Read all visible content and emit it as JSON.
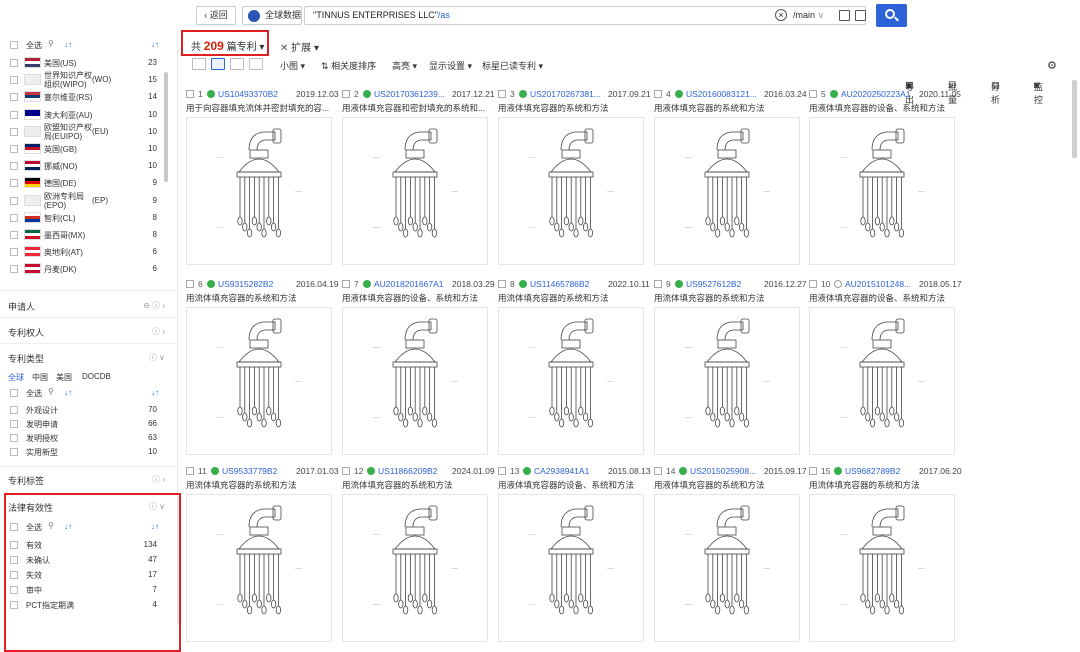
{
  "topbar": {
    "back_label": "返回",
    "scope_label": "全球数据",
    "query_main": "\"TINNUS ENTERPRISES LLC\"",
    "query_suffix": "/as",
    "field_select": "/main",
    "clear_icon": "close-circle-icon",
    "search_icon": "search-icon",
    "accent": "#2d62d8"
  },
  "sidebar": {
    "select_all": "全选",
    "countries": [
      {
        "label": "美国(US)",
        "count": "23",
        "flag": [
          "#b22234",
          "#fff",
          "#3c3b6e"
        ]
      },
      {
        "label": "世界知识产权组织(WIPO)",
        "label_short": "世界知识产权组织(WIPO)",
        "code": "(WO)",
        "count": "15",
        "flag": [
          "#eee",
          "#eee",
          "#eee"
        ]
      },
      {
        "label": "塞尔维亚(RS)",
        "count": "14",
        "flag": [
          "#c6363c",
          "#0c4076",
          "#fff"
        ]
      },
      {
        "label": "澳大利亚(AU)",
        "count": "10",
        "flag": [
          "#00008b",
          "#00008b",
          "#fff"
        ]
      },
      {
        "label": "欧盟知识产权局(EUIPO)",
        "code": "(EU)",
        "count": "10",
        "flag": [
          "#eee",
          "#eee",
          "#eee"
        ]
      },
      {
        "label": "英国(GB)",
        "count": "10",
        "flag": [
          "#012169",
          "#c8102e",
          "#fff"
        ]
      },
      {
        "label": "挪威(NO)",
        "count": "10",
        "flag": [
          "#ba0c2f",
          "#fff",
          "#00205b"
        ]
      },
      {
        "label": "德国(DE)",
        "count": "9",
        "flag": [
          "#000",
          "#dd0000",
          "#ffce00"
        ]
      },
      {
        "label": "欧洲专利局(EPO)",
        "code": "(EP)",
        "count": "9",
        "flag": [
          "#eee",
          "#eee",
          "#eee"
        ]
      },
      {
        "label": "智利(CL)",
        "count": "8",
        "flag": [
          "#fff",
          "#d52b1e",
          "#0039a6"
        ]
      },
      {
        "label": "墨西哥(MX)",
        "count": "8",
        "flag": [
          "#006847",
          "#fff",
          "#ce1126"
        ]
      },
      {
        "label": "奥地利(AT)",
        "count": "6",
        "flag": [
          "#ed2939",
          "#fff",
          "#ed2939"
        ]
      },
      {
        "label": "丹麦(DK)",
        "count": "6",
        "flag": [
          "#c60c30",
          "#fff",
          "#c60c30"
        ]
      }
    ],
    "sections": {
      "applicant": "申请人",
      "patentee": "专利权人",
      "patent_type": "专利类型",
      "patent_tabs": [
        "全球",
        "中国",
        "美国",
        "DOCDB"
      ],
      "patent_types": [
        {
          "label": "外观设计",
          "count": "70"
        },
        {
          "label": "发明申请",
          "count": "66"
        },
        {
          "label": "发明授权",
          "count": "63"
        },
        {
          "label": "实用新型",
          "count": "10"
        }
      ],
      "patent_tags": "专利标签",
      "legal_status": "法律有效性",
      "legal": [
        {
          "label": "有效",
          "count": "134"
        },
        {
          "label": "未确认",
          "count": "47"
        },
        {
          "label": "失效",
          "count": "17"
        },
        {
          "label": "审中",
          "count": "7"
        },
        {
          "label": "PCT指定期满",
          "count": "4"
        }
      ]
    }
  },
  "header": {
    "count_prefix": "共",
    "count": "209",
    "count_suffix": "篇专利",
    "expand": "扩展",
    "view_size": "小图",
    "sort": "相关度排序",
    "highlight": "高亮",
    "display": "显示设置",
    "read": "标星已读专利",
    "export": "导出",
    "batch": "批量",
    "analyze": "分析",
    "monitor": "监控"
  },
  "cards": [
    {
      "num": "1",
      "pn": "US10493370B2",
      "date": "2019.12.03",
      "title": "用于向容器填充流体并密封填充的容...",
      "status": "green"
    },
    {
      "num": "2",
      "pn": "US20170361239...",
      "date": "2017.12.21",
      "title": "用液体填充容器和密封填充的系统和...",
      "status": "green"
    },
    {
      "num": "3",
      "pn": "US20170267381...",
      "date": "2017.09.21",
      "title": "用液体填充容器的系统和方法",
      "status": "green"
    },
    {
      "num": "4",
      "pn": "US20160083121...",
      "date": "2016.03.24",
      "title": "用液体填充容器的系统和方法",
      "status": "green"
    },
    {
      "num": "5",
      "pn": "AU2020250223A1",
      "date": "2020.11.05",
      "title": "用液体填充容器的设备、系统和方法",
      "status": "green"
    },
    {
      "num": "6",
      "pn": "US9315282B2",
      "date": "2016.04.19",
      "title": "用流体填充容器的系统和方法",
      "status": "green"
    },
    {
      "num": "7",
      "pn": "AU2018201667A1",
      "date": "2018.03.29",
      "title": "用液体填充容器的设备、系统和方法",
      "status": "green"
    },
    {
      "num": "8",
      "pn": "US11465786B2",
      "date": "2022.10.11",
      "title": "用流体填充容器的系统和方法",
      "status": "green"
    },
    {
      "num": "9",
      "pn": "US9527612B2",
      "date": "2016.12.27",
      "title": "用流体填充容器的系统和方法",
      "status": "green"
    },
    {
      "num": "10",
      "pn": "AU2015101248...",
      "date": "2018.05.17",
      "title": "用液体填充容器的设备、系统和方法",
      "status": "grey"
    },
    {
      "num": "11",
      "pn": "US9533779B2",
      "date": "2017.01.03",
      "title": "用流体填充容器的系统和方法",
      "status": "green"
    },
    {
      "num": "12",
      "pn": "US11866209B2",
      "date": "2024.01.09",
      "title": "用流体填充容器的系统和方法",
      "status": "green"
    },
    {
      "num": "13",
      "pn": "CA2938941A1",
      "date": "2015.08.13",
      "title": "用液体填充容器的设备、系统和方法",
      "status": "green"
    },
    {
      "num": "14",
      "pn": "US2015025908...",
      "date": "2015.09.17",
      "title": "用液体填充容器的系统和方法",
      "status": "green"
    },
    {
      "num": "15",
      "pn": "US9682789B2",
      "date": "2017.06.20",
      "title": "用流体填充容器的系统和方法",
      "status": "green"
    }
  ]
}
